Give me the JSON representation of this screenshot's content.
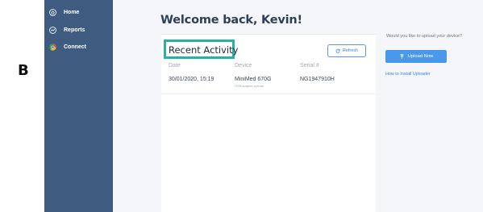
{
  "panel_label": "B",
  "sidebar": {
    "items": [
      {
        "label": "Home",
        "icon": "home-icon",
        "active": true
      },
      {
        "label": "Reports",
        "icon": "reports-icon",
        "active": false
      },
      {
        "label": "Connect",
        "icon": "connect-icon",
        "active": false
      }
    ]
  },
  "main": {
    "welcome": "Welcome back, Kevin!",
    "recent_activity": {
      "title": "Recent Activity",
      "refresh_label": "Refresh",
      "columns": [
        "Date",
        "Device",
        "Serial #"
      ],
      "rows": [
        {
          "date": "30/01/2020, 15:19",
          "device": "MiniMed 670G",
          "device_sub": "USB/adapter upload",
          "serial": "NG1947910H"
        }
      ]
    }
  },
  "upload_panel": {
    "question": "Would you like to upload your device?",
    "button_label": "Upload Now",
    "install_link": "How to Install Uploader"
  },
  "colors": {
    "sidebar": "#3f5c80",
    "highlight": "#26b3a1",
    "primary": "#4a98e9"
  }
}
